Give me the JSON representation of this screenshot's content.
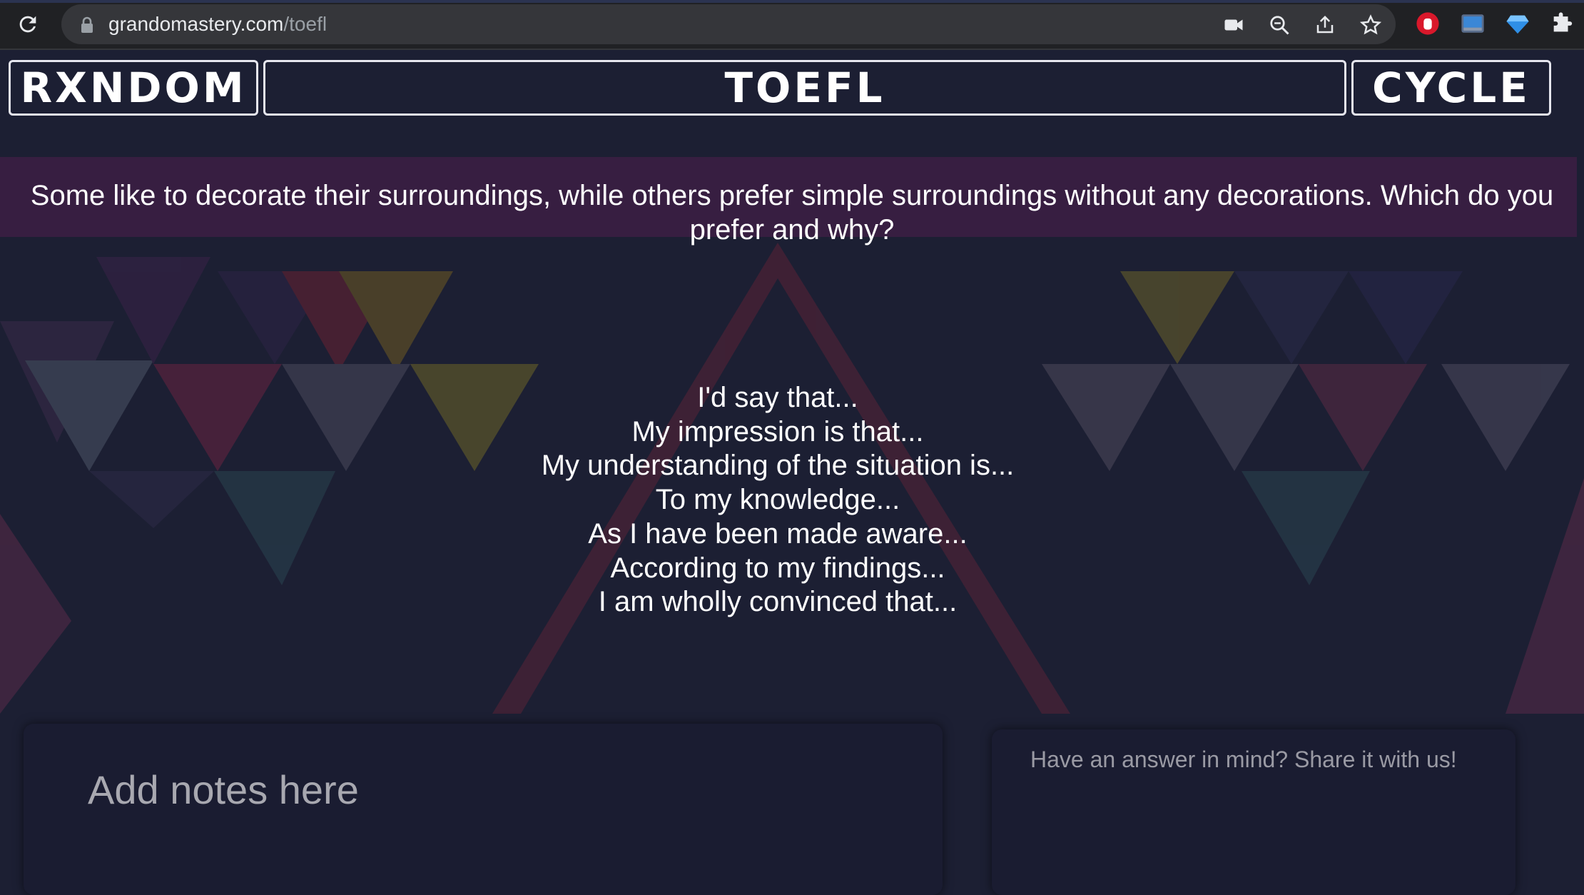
{
  "browser": {
    "url_host": "grandomastery.com",
    "url_path": "/toefl"
  },
  "header": {
    "left_label": "RXNDOM",
    "center_label": "TOEFL",
    "right_label": "CYCLE"
  },
  "question": "Some like to decorate their surroundings, while others prefer simple surroundings without any decorations. Which do you prefer and why?",
  "phrases": [
    "I'd say that...",
    "My impression is that...",
    "My understanding of the situation is...",
    "To my knowledge...",
    "As I have been made aware...",
    "According to my findings...",
    "I am wholly convinced that..."
  ],
  "notes": {
    "placeholder": "Add notes here"
  },
  "answer": {
    "placeholder": "Have an answer in mind? Share it with us!"
  },
  "colors": {
    "page_background": "#1c1f33",
    "question_band": "#3a1e42"
  }
}
